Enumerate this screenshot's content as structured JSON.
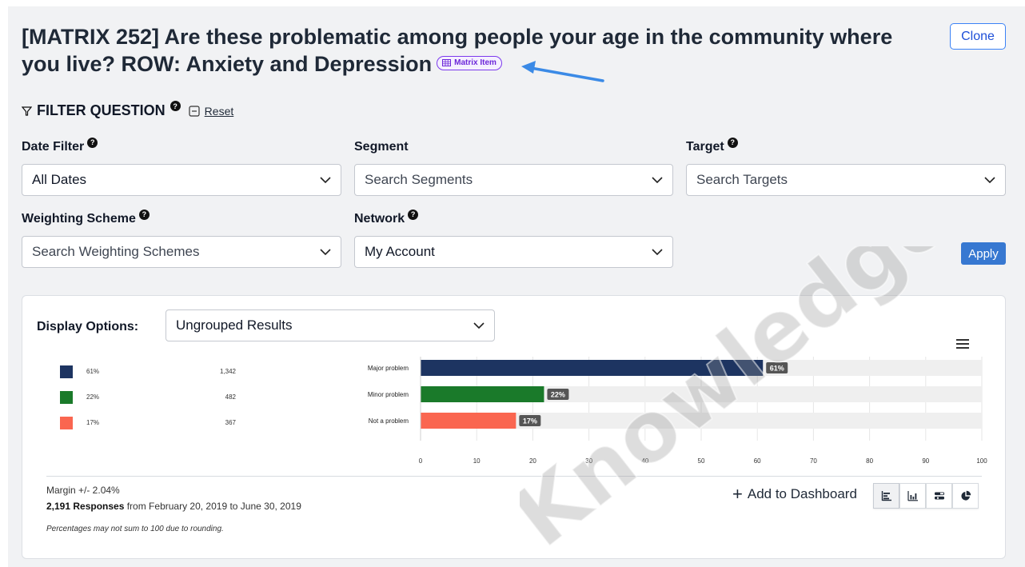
{
  "header": {
    "title": "[MATRIX 252] Are these problematic among people your age in the community where you live? ROW: Anxiety and Depression",
    "badge_label": "Matrix Item",
    "clone_label": "Clone"
  },
  "filter": {
    "title": "FILTER QUESTION",
    "reset_label": "Reset",
    "help_glyph": "?"
  },
  "fields": {
    "date_filter": {
      "label": "Date Filter",
      "value": "All Dates"
    },
    "segment": {
      "label": "Segment",
      "placeholder": "Search Segments"
    },
    "target": {
      "label": "Target",
      "placeholder": "Search Targets"
    },
    "weighting": {
      "label": "Weighting Scheme",
      "placeholder": "Search Weighting Schemes"
    },
    "network": {
      "label": "Network",
      "value": "My Account"
    },
    "apply_label": "Apply"
  },
  "display": {
    "label": "Display Options:",
    "value": "Ungrouped Results"
  },
  "legend": [
    {
      "pct": "61%",
      "count": "1,342",
      "color": "#1d3461"
    },
    {
      "pct": "22%",
      "count": "482",
      "color": "#1a7a2a"
    },
    {
      "pct": "17%",
      "count": "367",
      "color": "#fa6650"
    }
  ],
  "chart_data": {
    "type": "bar",
    "orientation": "horizontal",
    "categories": [
      "Major problem",
      "Minor problem",
      "Not a problem"
    ],
    "values": [
      61,
      22,
      17
    ],
    "data_labels": [
      "61%",
      "22%",
      "17%"
    ],
    "colors": [
      "#1d3461",
      "#1a7a2a",
      "#fa6650"
    ],
    "xlim": [
      0,
      100
    ],
    "x_ticks": [
      "0",
      "10",
      "20",
      "30",
      "40",
      "50",
      "60",
      "70",
      "80",
      "90",
      "100"
    ],
    "grid": true
  },
  "footer": {
    "margin": "Margin +/- 2.04%",
    "responses_bold": "2,191 Responses",
    "responses_rest": " from February 20, 2019 to June 30, 2019",
    "rounding_note": "Percentages may not sum to 100 due to rounding.",
    "add_dashboard_label": "Add to Dashboard"
  },
  "watermark_text": "Knowledge Base"
}
